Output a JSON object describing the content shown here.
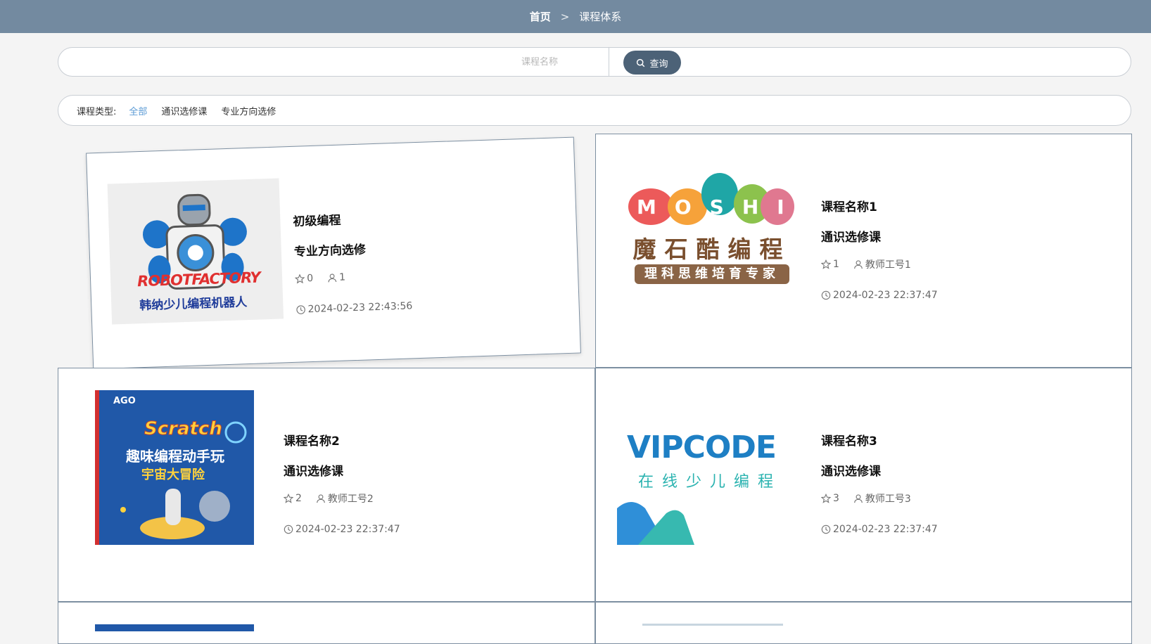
{
  "breadcrumb": {
    "home": "首页",
    "separator": ">",
    "current": "课程体系"
  },
  "search": {
    "placeholder": "课程名称",
    "value": "",
    "button_label": "查询"
  },
  "filter": {
    "label": "课程类型:",
    "options": [
      {
        "label": "全部",
        "active": true
      },
      {
        "label": "通识选修课",
        "active": false
      },
      {
        "label": "专业方向选修",
        "active": false
      }
    ]
  },
  "courses": [
    {
      "name": "初级编程",
      "type": "专业方向选修",
      "stars": "0",
      "teacher": "1",
      "time": "2024-02-23 22:43:56",
      "image": {
        "caption_line1": "ROBOTFACTORY",
        "caption_line2": "韩纳少儿编程机器人"
      }
    },
    {
      "name": "课程名称1",
      "type": "通识选修课",
      "stars": "1",
      "teacher": "教师工号1",
      "time": "2024-02-23 22:37:47",
      "image": {
        "letters": "MOSHI",
        "title": "魔石酷编程",
        "subtitle": "理科思维培育专家"
      }
    },
    {
      "name": "课程名称2",
      "type": "通识选修课",
      "stars": "2",
      "teacher": "教师工号2",
      "time": "2024-02-23 22:37:47",
      "image": {
        "brand": "AGO",
        "title": "Scratch",
        "line1": "趣味编程动手玩",
        "line2": "宇宙大冒险"
      }
    },
    {
      "name": "课程名称3",
      "type": "通识选修课",
      "stars": "3",
      "teacher": "教师工号3",
      "time": "2024-02-23 22:37:47",
      "image": {
        "brand": "VIPCODE",
        "subtitle": "在线少儿编程"
      }
    }
  ],
  "icons": {
    "search": "search-icon",
    "star": "star-icon",
    "user": "user-icon",
    "clock": "clock-icon"
  },
  "colors": {
    "header": "#738aa0",
    "button": "#4c6277",
    "active_filter": "#5b9bd5"
  }
}
